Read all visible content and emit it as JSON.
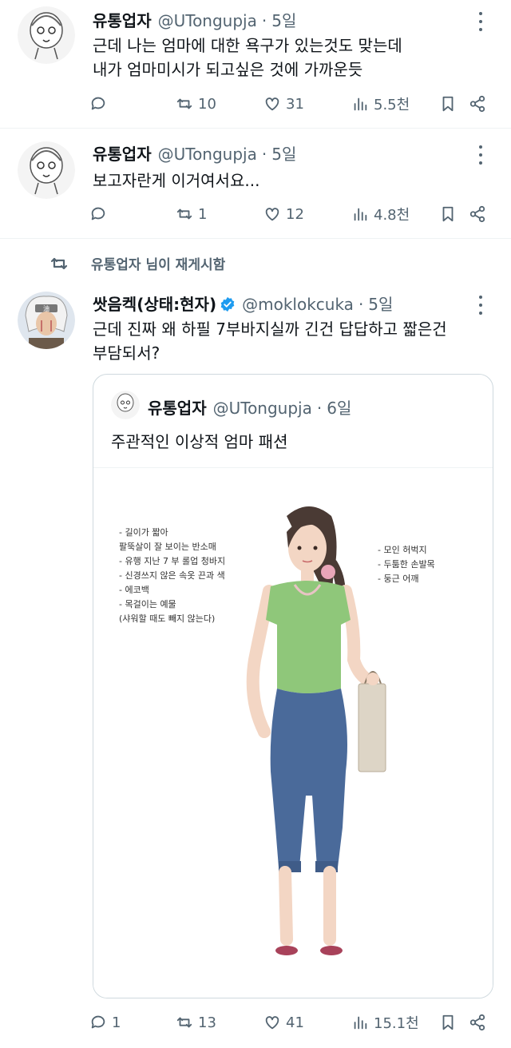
{
  "tweets": [
    {
      "name": "유통업자",
      "handle": "@UTongupja",
      "time": "5일",
      "text": "근데 나는 엄마에 대한 욕구가 있는것도 맞는데\n내가 엄마미시가 되고싶은 것에 가까운듯",
      "replies": "",
      "retweets": "10",
      "likes": "31",
      "views": "5.5천"
    },
    {
      "name": "유통업자",
      "handle": "@UTongupja",
      "time": "5일",
      "text": "보고자란게 이거여서요...",
      "replies": "",
      "retweets": "1",
      "likes": "12",
      "views": "4.8천"
    },
    {
      "name": "쌋음켁(상태:현자)",
      "handle": "@moklokcuka",
      "time": "5일",
      "text": "근데 진짜 왜 하필 7부바지실까 긴건 답답하고 짧은건\n부담되서?",
      "replies": "1",
      "retweets": "13",
      "likes": "41",
      "views": "15.1천"
    }
  ],
  "retweet_banner": "유통업자 님이 재게시함",
  "quote": {
    "name": "유통업자",
    "handle": "@UTongupja",
    "time": "6일",
    "text": "주관적인 이상적 엄마 패션",
    "notes_left": [
      "- 길이가 짧아",
      "  팔뚝살이 잘 보이는 반소매",
      "- 유행 지난 7 부 롤업 청바지",
      "- 신경쓰지 않은 속옷 끈과 색",
      "- 에코백",
      "- 목걸이는 예물",
      "  (샤워할 때도 빼지 않는다)"
    ],
    "notes_right": [
      "- 모인 허벅지",
      "- 두툼한 손발목",
      "- 둥근 어깨"
    ]
  },
  "colors": {
    "text": "#0f1419",
    "secondary": "#536471",
    "border": "#cfd9de",
    "verified": "#1d9bf0",
    "shirt": "#8fc77a",
    "jeans": "#4a6a9a"
  },
  "icons": [
    "reply-icon",
    "retweet-icon",
    "like-icon",
    "views-icon",
    "bookmark-icon",
    "share-icon",
    "more-icon",
    "verified-icon"
  ]
}
